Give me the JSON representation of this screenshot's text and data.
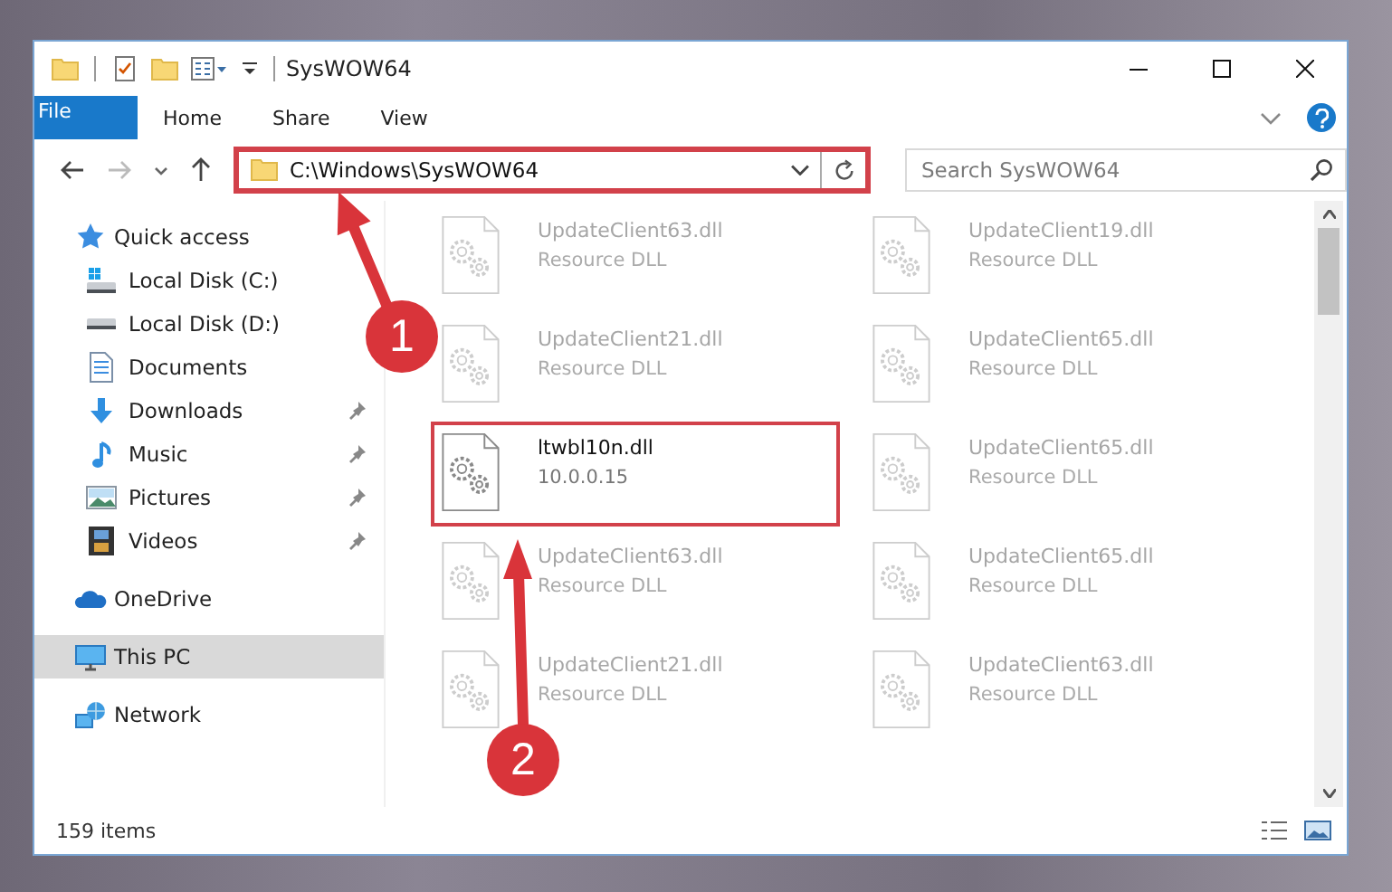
{
  "window": {
    "title": "SysWOW64"
  },
  "ribbon": {
    "tabs": [
      {
        "label": "File",
        "kind": "file",
        "selected": false
      },
      {
        "label": "Home",
        "kind": "tab",
        "selected": false
      },
      {
        "label": "Share",
        "kind": "tab",
        "selected": false
      },
      {
        "label": "View",
        "kind": "tab",
        "selected": false
      }
    ]
  },
  "address_bar": {
    "path": "C:\\Windows\\SysWOW64",
    "highlighted": true
  },
  "search": {
    "placeholder": "Search SysWOW64"
  },
  "navigation": {
    "items": [
      {
        "label": "Quick access",
        "kind": "star",
        "selected": false,
        "children": [
          {
            "label": "Local Disk (C:)",
            "kind": "drive-windows",
            "pinned": false
          },
          {
            "label": "Local Disk (D:)",
            "kind": "drive",
            "pinned": false
          },
          {
            "label": "Documents",
            "kind": "document",
            "pinned": false
          },
          {
            "label": "Downloads",
            "kind": "download",
            "pinned": true
          },
          {
            "label": "Music",
            "kind": "music",
            "pinned": true
          },
          {
            "label": "Pictures",
            "kind": "picture",
            "pinned": true
          },
          {
            "label": "Videos",
            "kind": "video",
            "pinned": true
          }
        ]
      },
      {
        "label": "OneDrive",
        "kind": "cloud",
        "selected": false
      },
      {
        "label": "This PC",
        "kind": "computer",
        "selected": true
      },
      {
        "label": "Network",
        "kind": "network",
        "selected": false
      }
    ]
  },
  "files": [
    {
      "name": "UpdateClient63.dll",
      "detail": "Resource DLL",
      "blurred": true,
      "highlighted": false
    },
    {
      "name": "UpdateClient19.dll",
      "detail": "Resource DLL",
      "blurred": true,
      "highlighted": false
    },
    {
      "name": "UpdateClient21.dll",
      "detail": "Resource DLL",
      "blurred": true,
      "highlighted": false
    },
    {
      "name": "UpdateClient65.dll",
      "detail": "Resource DLL",
      "blurred": true,
      "highlighted": false
    },
    {
      "name": "ltwbl10n.dll",
      "detail": "10.0.0.15",
      "blurred": false,
      "highlighted": true
    },
    {
      "name": "UpdateClient65.dll",
      "detail": "Resource DLL",
      "blurred": true,
      "highlighted": false
    },
    {
      "name": "UpdateClient63.dll",
      "detail": "Resource DLL",
      "blurred": true,
      "highlighted": false
    },
    {
      "name": "UpdateClient65.dll",
      "detail": "Resource DLL",
      "blurred": true,
      "highlighted": false
    },
    {
      "name": "UpdateClient21.dll",
      "detail": "Resource DLL",
      "blurred": true,
      "highlighted": false
    },
    {
      "name": "UpdateClient63.dll",
      "detail": "Resource DLL",
      "blurred": true,
      "highlighted": false
    }
  ],
  "annotations": [
    {
      "label": "1"
    },
    {
      "label": "2"
    }
  ],
  "status_bar": {
    "item_count": "159 items"
  }
}
